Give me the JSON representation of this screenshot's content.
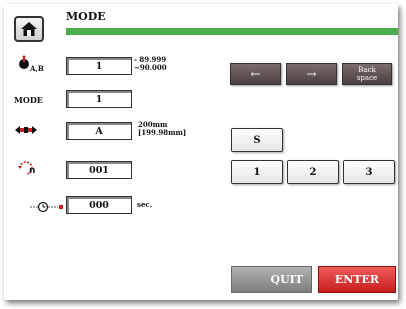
{
  "header": {
    "title": "MODE",
    "home_icon": "home-icon"
  },
  "rows": {
    "ab": {
      "sub_label": "A,B",
      "icon": "ab-axis-icon",
      "value": "1",
      "range": [
        "- 89.999",
        "~90.000"
      ]
    },
    "mode": {
      "label": "MODE",
      "value": "1"
    },
    "size": {
      "icon": "clamp-icon",
      "value": "A",
      "note": [
        "200mm",
        "[199.98mm]"
      ]
    },
    "count": {
      "icon": "cycle-counter-icon",
      "value": "001"
    },
    "timer": {
      "icon": "timer-icon",
      "value": "000",
      "unit": "sec."
    }
  },
  "keys": {
    "left": "←",
    "right": "→",
    "backspace": [
      "Back",
      "space"
    ],
    "s": "S",
    "one": "1",
    "two": "2",
    "three": "3"
  },
  "footer": {
    "quit": "QUIT",
    "enter": "ENTER"
  },
  "colors": {
    "accent_green": "#4cae4c",
    "enter_red": "#d63030",
    "dark_key": "#5c4e4e"
  }
}
